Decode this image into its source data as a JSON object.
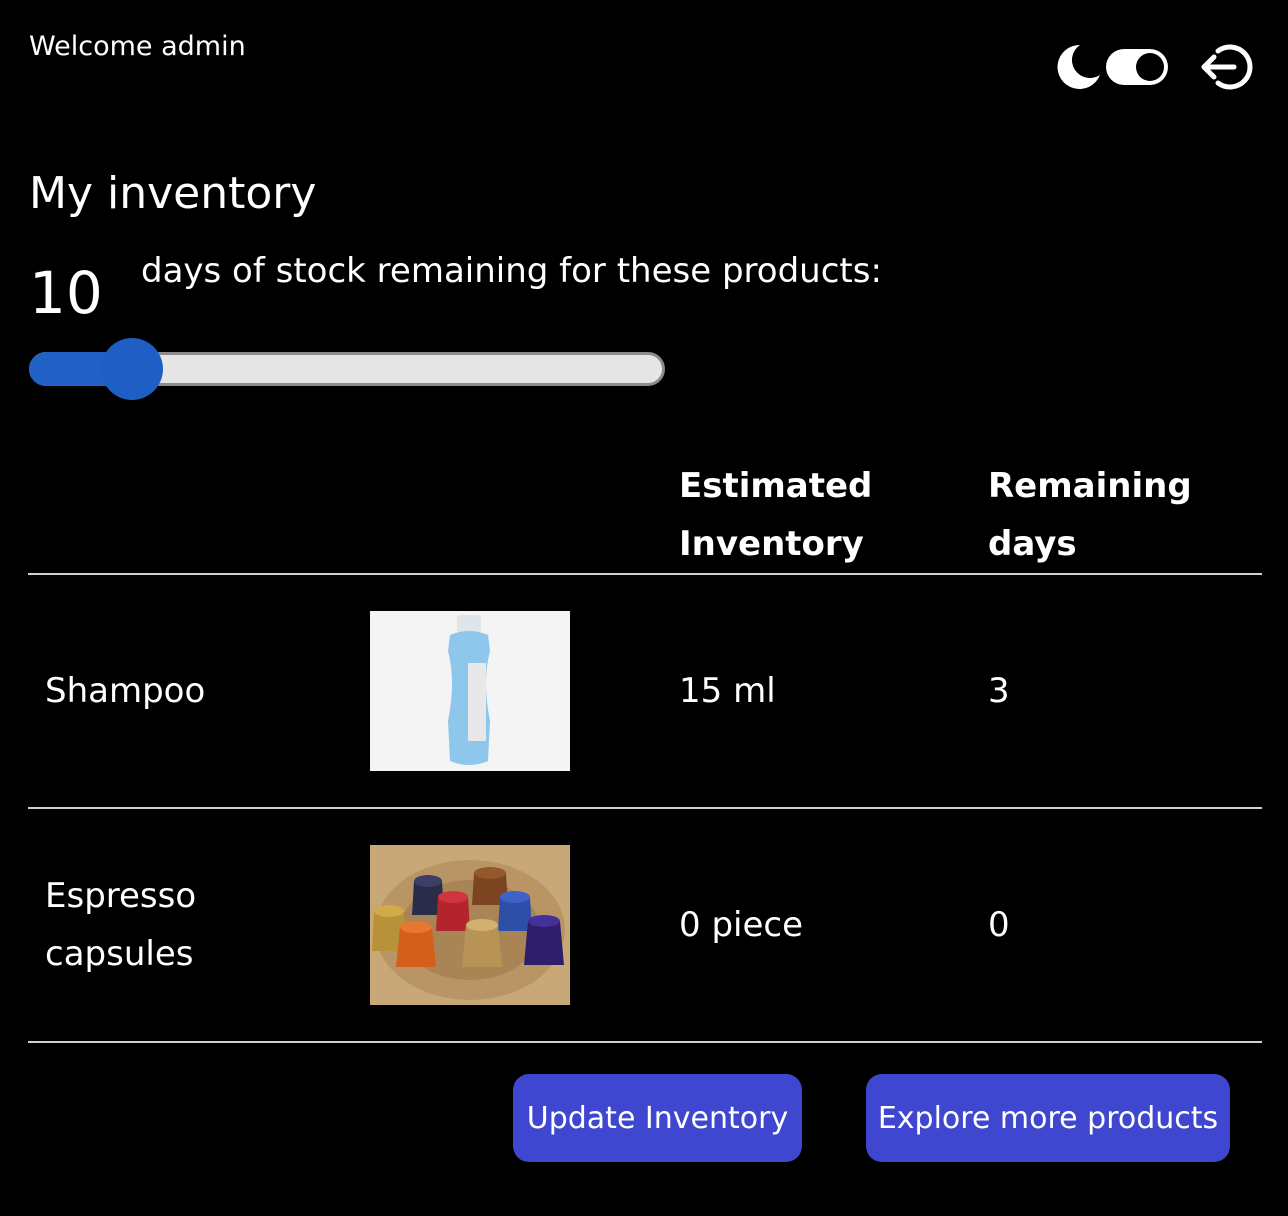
{
  "header": {
    "welcome": "Welcome admin",
    "icons": [
      "moon-icon",
      "theme-toggle",
      "logout-icon"
    ]
  },
  "inventory": {
    "title": "My inventory",
    "days_value": "10",
    "days_text": "days of stock remaining for these products:",
    "slider_fraction": 0.14
  },
  "table": {
    "headers": {
      "name": "",
      "image": "",
      "estimated_line1": "Estimated",
      "estimated_line2": "Inventory",
      "remaining_line1": "Remaining",
      "remaining_line2": "days"
    },
    "rows": [
      {
        "name": "Shampoo",
        "image": "shampoo-bottle",
        "estimated": "15 ml",
        "remaining": "3"
      },
      {
        "name_line1": "Espresso",
        "name_line2": "capsules",
        "image": "espresso-capsules",
        "estimated": "0 piece",
        "remaining": "0"
      }
    ]
  },
  "buttons": {
    "update": "Update Inventory",
    "explore": "Explore more products"
  },
  "colors": {
    "background": "#000000",
    "accent_button": "#3f47d0",
    "slider_blue": "#2160c4"
  }
}
